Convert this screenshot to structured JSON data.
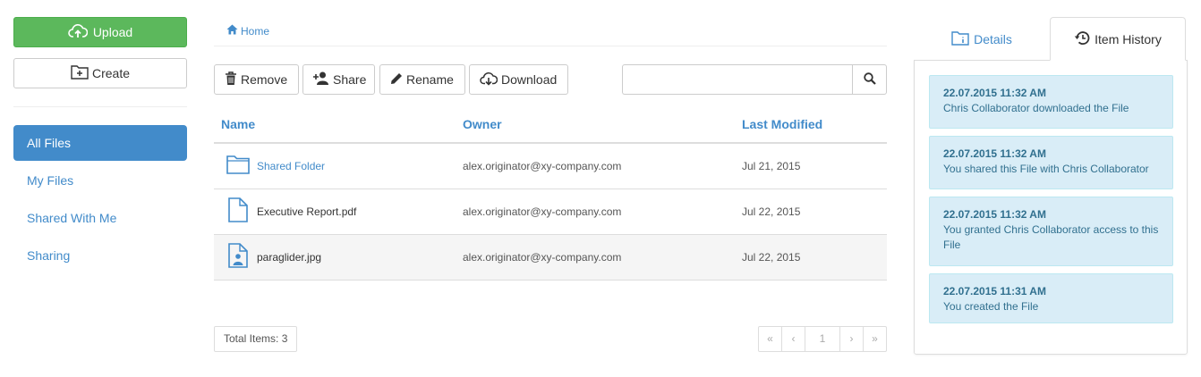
{
  "sidebar": {
    "upload_label": "Upload",
    "create_label": "Create",
    "nav": [
      {
        "label": "All Files",
        "active": true
      },
      {
        "label": "My Files"
      },
      {
        "label": "Shared With Me"
      },
      {
        "label": "Sharing"
      }
    ]
  },
  "breadcrumb": {
    "home": "Home"
  },
  "toolbar": {
    "remove": "Remove",
    "share": "Share",
    "rename": "Rename",
    "download": "Download",
    "search_value": ""
  },
  "table": {
    "columns": [
      "Name",
      "Owner",
      "Last Modified"
    ],
    "rows": [
      {
        "icon": "folder-icon",
        "name": "Shared Folder",
        "owner": "alex.originator@xy-company.com",
        "modified": "Jul 21, 2015"
      },
      {
        "icon": "document-icon",
        "name": "Executive Report.pdf",
        "owner": "alex.originator@xy-company.com",
        "modified": "Jul 22, 2015"
      },
      {
        "icon": "image-file-icon",
        "name": "paraglider.jpg",
        "owner": "alex.originator@xy-company.com",
        "modified": "Jul 22, 2015"
      }
    ]
  },
  "footer": {
    "total": "Total Items: 3",
    "pager": {
      "first": "«",
      "prev": "‹",
      "page": "1",
      "next": "›",
      "last": "»"
    }
  },
  "panel": {
    "tabs": {
      "details": "Details",
      "history": "Item History"
    },
    "history": [
      {
        "time": "22.07.2015 11:32 AM",
        "text": "Chris Collaborator downloaded the File"
      },
      {
        "time": "22.07.2015 11:32 AM",
        "text": "You shared this File with Chris Collaborator"
      },
      {
        "time": "22.07.2015 11:32 AM",
        "text": "You granted Chris Collaborator access to this File"
      },
      {
        "time": "22.07.2015 11:31 AM",
        "text": "You created the File"
      }
    ]
  },
  "colors": {
    "primary": "#428bca",
    "success": "#5cb85c",
    "info_bg": "#d9edf7",
    "info_text": "#31708f"
  }
}
